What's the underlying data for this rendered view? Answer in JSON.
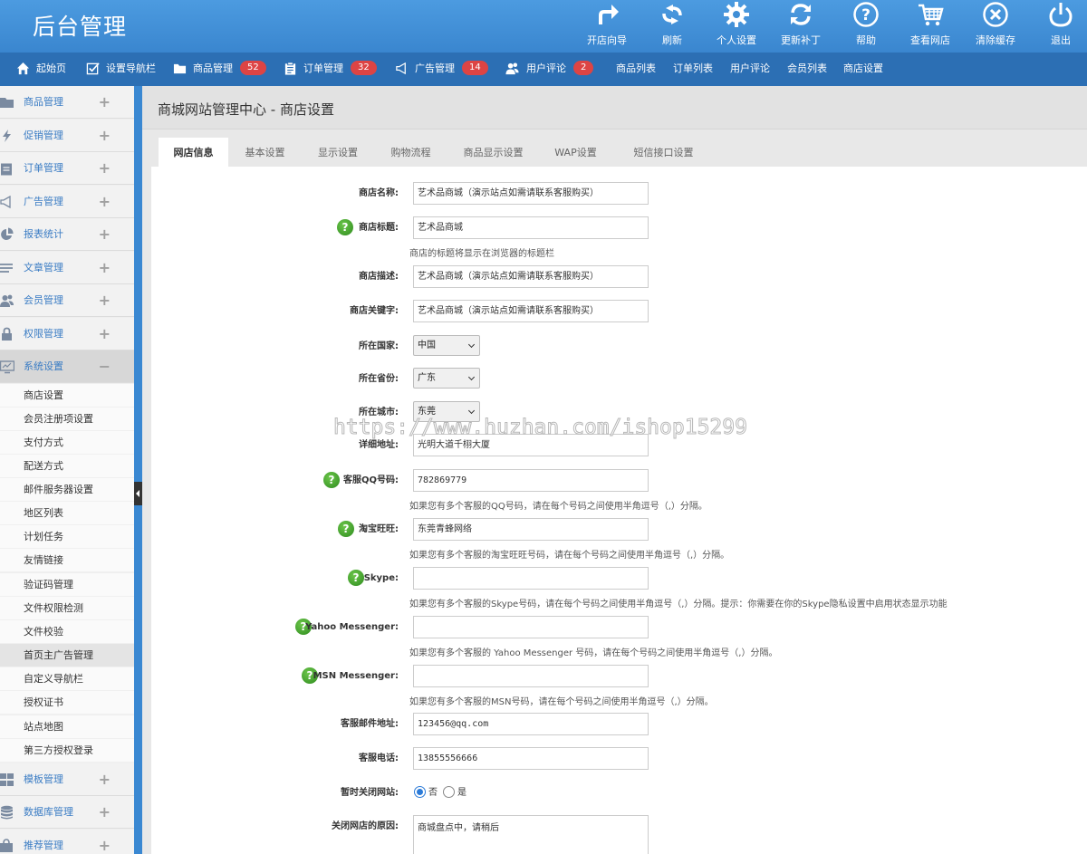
{
  "header": {
    "brand": "后台管理",
    "tools": [
      {
        "label": "开店向导",
        "icon": "redo-arrow-icon"
      },
      {
        "label": "刷新",
        "icon": "refresh-icon"
      },
      {
        "label": "个人设置",
        "icon": "gear-icon"
      },
      {
        "label": "更新补丁",
        "icon": "sync-icon"
      },
      {
        "label": "帮助",
        "icon": "question-icon"
      },
      {
        "label": "查看网店",
        "icon": "cart-icon"
      },
      {
        "label": "清除缓存",
        "icon": "clear-icon"
      },
      {
        "label": "退出",
        "icon": "power-icon"
      }
    ]
  },
  "navbar": {
    "items": [
      {
        "label": "起始页",
        "icon": "home-icon"
      },
      {
        "label": "设置导航栏",
        "icon": "checkbox-icon"
      },
      {
        "label": "商品管理",
        "icon": "folder-icon",
        "badge": "52"
      },
      {
        "label": "订单管理",
        "icon": "clipboard-icon",
        "badge": "32"
      },
      {
        "label": "广告管理",
        "icon": "megaphone-icon",
        "badge": "14"
      },
      {
        "label": "用户评论",
        "icon": "users-icon",
        "badge": "2"
      },
      {
        "label": "商品列表"
      },
      {
        "label": "订单列表"
      },
      {
        "label": "用户评论"
      },
      {
        "label": "会员列表"
      },
      {
        "label": "商店设置"
      }
    ]
  },
  "sidebar": {
    "groups_top": [
      {
        "label": "商品管理",
        "icon": "folder-icon",
        "toggle": "+"
      },
      {
        "label": "促销管理",
        "icon": "bolt-icon",
        "toggle": "+"
      },
      {
        "label": "订单管理",
        "icon": "clipboard-icon",
        "toggle": "+"
      },
      {
        "label": "广告管理",
        "icon": "megaphone-icon",
        "toggle": "+"
      },
      {
        "label": "报表统计",
        "icon": "pie-chart-icon",
        "toggle": "+"
      },
      {
        "label": "文章管理",
        "icon": "list-icon",
        "toggle": "+"
      },
      {
        "label": "会员管理",
        "icon": "users-icon",
        "toggle": "+"
      },
      {
        "label": "权限管理",
        "icon": "lock-icon",
        "toggle": "+"
      },
      {
        "label": "系统设置",
        "icon": "monitor-icon",
        "toggle": "−"
      }
    ],
    "sub_items": [
      "商店设置",
      "会员注册项设置",
      "支付方式",
      "配送方式",
      "邮件服务器设置",
      "地区列表",
      "计划任务",
      "友情链接",
      "验证码管理",
      "文件权限检测",
      "文件校验",
      "首页主广告管理",
      "自定义导航栏",
      "授权证书",
      "站点地图",
      "第三方授权登录"
    ],
    "active_sub": "首页主广告管理",
    "groups_bottom": [
      {
        "label": "模板管理",
        "icon": "grid-icon",
        "toggle": "+"
      },
      {
        "label": "数据库管理",
        "icon": "database-icon",
        "toggle": "+"
      },
      {
        "label": "推荐管理",
        "icon": "share-icon",
        "toggle": "+"
      }
    ]
  },
  "page": {
    "title": "商城网站管理中心 - 商店设置",
    "tabs": [
      "网店信息",
      "基本设置",
      "显示设置",
      "购物流程",
      "商品显示设置",
      "WAP设置",
      "短信接口设置"
    ],
    "active_tab": "网店信息"
  },
  "form": {
    "shop_name": {
      "label": "商店名称:",
      "value": "艺术品商城（演示站点如需请联系客服购买）"
    },
    "shop_title": {
      "label": "商店标题:",
      "value": "艺术品商城",
      "hint": "商店的标题将显示在浏览器的标题栏"
    },
    "shop_desc": {
      "label": "商店描述:",
      "value": "艺术品商城（演示站点如需请联系客服购买）"
    },
    "shop_keywords": {
      "label": "商店关键字:",
      "value": "艺术品商城（演示站点如需请联系客服购买）"
    },
    "country": {
      "label": "所在国家:",
      "value": "中国"
    },
    "province": {
      "label": "所在省份:",
      "value": "广东"
    },
    "city": {
      "label": "所在城市:",
      "value": "东莞"
    },
    "address": {
      "label": "详细地址:",
      "value": "光明大道千栩大厦"
    },
    "qq": {
      "label": "客服QQ号码:",
      "value": "782869779",
      "hint": "如果您有多个客服的QQ号码，请在每个号码之间使用半角逗号（,）分隔。"
    },
    "wangwang": {
      "label": "淘宝旺旺:",
      "value": "东莞青蜂网络",
      "hint": "如果您有多个客服的淘宝旺旺号码，请在每个号码之间使用半角逗号（,）分隔。"
    },
    "skype": {
      "label": "Skype:",
      "value": "",
      "hint": "如果您有多个客服的Skype号码，请在每个号码之间使用半角逗号（,）分隔。提示：你需要在你的Skype隐私设置中启用状态显示功能"
    },
    "yahoo": {
      "label": "Yahoo Messenger:",
      "value": "",
      "hint": "如果您有多个客服的 Yahoo Messenger 号码，请在每个号码之间使用半角逗号（,）分隔。"
    },
    "msn": {
      "label": "MSN Messenger:",
      "value": "",
      "hint": "如果您有多个客服的MSN号码，请在每个号码之间使用半角逗号（,）分隔。"
    },
    "email": {
      "label": "客服邮件地址:",
      "value": "123456@qq.com"
    },
    "phone": {
      "label": "客服电话:",
      "value": "13855556666"
    },
    "close_site": {
      "label": "暂时关闭网站:",
      "options": [
        "否",
        "是"
      ],
      "selected": "否"
    },
    "close_reason": {
      "label": "关闭网店的原因:",
      "value": "商城盘点中，请稍后"
    }
  },
  "watermark": "https://www.huzhan.com/ishop15299",
  "colors": {
    "header": "#3f8ed6",
    "navbar": "#2c6fb4",
    "badge": "#dd4444",
    "help": "#3a9a2a",
    "link": "#3a7cc4"
  }
}
